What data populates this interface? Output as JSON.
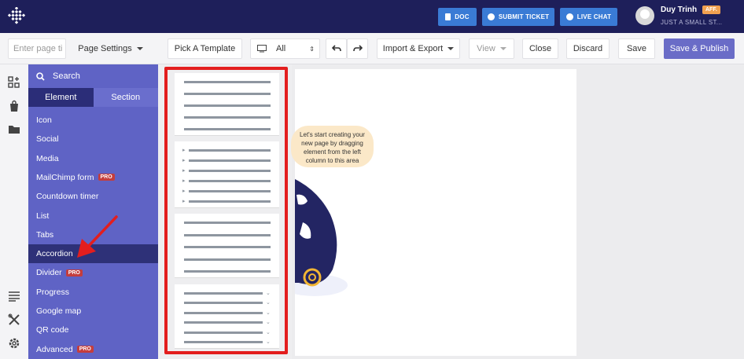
{
  "header": {
    "doc_label": "DOC",
    "ticket_label": "SUBMIT TICKET",
    "chat_label": "LIVE CHAT",
    "user_name": "Duy Trinh",
    "aff_badge": "AFF.",
    "store_name": "JUST A SMALL ST..."
  },
  "toolbar": {
    "page_input_placeholder": "Enter page ti",
    "page_settings": "Page Settings",
    "pick_template": "Pick A Template",
    "device_select": "All",
    "import_export": "Import & Export",
    "view": "View",
    "close": "Close",
    "discard": "Discard",
    "save": "Save",
    "save_publish": "Save & Publish"
  },
  "panel": {
    "search_placeholder": "Search",
    "tabs": [
      "Element",
      "Section"
    ],
    "items": [
      {
        "label": "Icon",
        "pro": false
      },
      {
        "label": "Social",
        "pro": false
      },
      {
        "label": "Media",
        "pro": false
      },
      {
        "label": "MailChimp form",
        "pro": true
      },
      {
        "label": "Countdown timer",
        "pro": false
      },
      {
        "label": "List",
        "pro": false
      },
      {
        "label": "Tabs",
        "pro": false
      },
      {
        "label": "Accordion",
        "pro": false
      },
      {
        "label": "Divider",
        "pro": true
      },
      {
        "label": "Progress",
        "pro": false
      },
      {
        "label": "Google map",
        "pro": false
      },
      {
        "label": "QR code",
        "pro": false
      },
      {
        "label": "Advanced",
        "pro": true
      }
    ],
    "pro_label": "PRO"
  },
  "canvas": {
    "hint_line1": "Let's start creating your",
    "hint_line2": "new page by dragging",
    "hint_line3": "element from the left",
    "hint_line4": "column to this area"
  },
  "colors": {
    "topbar": "#1e1f5a",
    "panel": "#5f63c5",
    "active_item": "#2e3178",
    "highlight": "#e31e1e",
    "button_blue": "#3a7bd5",
    "save_publish": "#6a6cc7"
  }
}
